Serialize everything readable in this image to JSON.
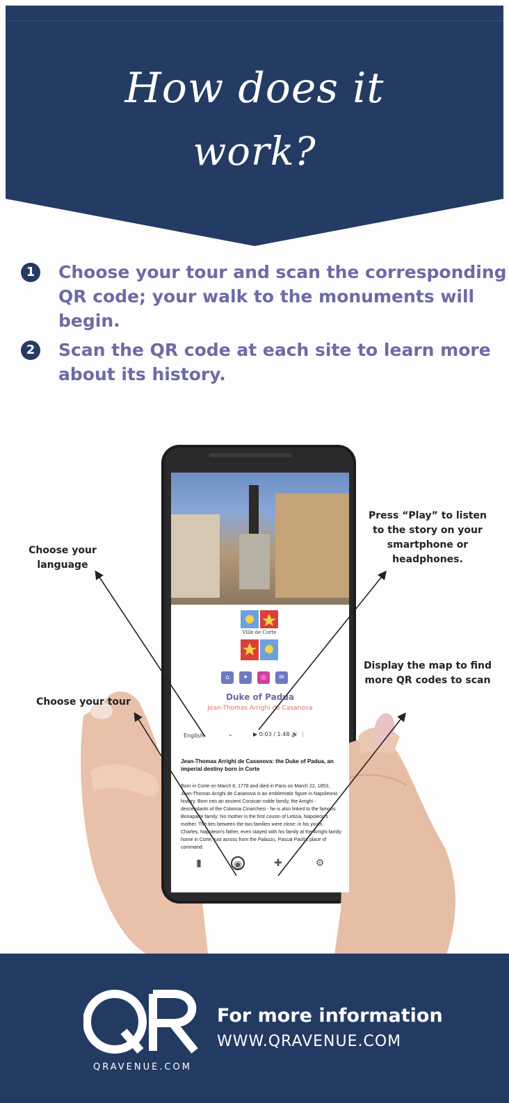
{
  "colors": {
    "navy": "#243b63",
    "step_text": "#6e6aa6",
    "subtitle_red": "#e06b68",
    "white": "#ffffff"
  },
  "header": {
    "title_line1": "How does it",
    "title_line2": "work?"
  },
  "steps": [
    {
      "number": "1",
      "text": "Choose your tour and scan the corresponding QR code; your walk to the monuments will begin."
    },
    {
      "number": "2",
      "text": "Scan the QR code at each site to learn more about its history."
    }
  ],
  "callouts": {
    "language": "Choose your language",
    "tour": "Choose your tour",
    "play": "Press “Play” to listen to the story on your smartphone or headphones.",
    "map": "Display the map to find more QR codes to scan"
  },
  "phone": {
    "coat_label": "Ville de Corte",
    "social_icons": [
      "home-icon",
      "twitter-icon",
      "instagram-icon",
      "mail-icon"
    ],
    "title": "Duke of Padua",
    "subtitle": "Jean-Thomas Arrighi de Casanova",
    "language_value": "English",
    "player_time": "0:03 / 1:48",
    "article_title": "Jean-Thomas Arrighi de Casanova: the Duke of Padua, an imperial destiny born in Corte",
    "article_body": "Born in Corte on March 8, 1778 and died in Paris on March 22, 1853, Jean-Thomas Arrighi de Casanova is an emblematic figure in Napoleonic history. Born into an ancient Corsican noble family, the Arrighi - descendants of the Colonna Cinarchesi - he is also linked to the famous Bonaparte family: his mother is the first cousin of Letizia, Napoleon's mother. The ties between the two families were close: in his youth, Charles, Napoleon's father, even stayed with his family at the Arrighi family home in Corte, just across from the Palazzu, Pascal Paoli's place of command.",
    "nav_icons": [
      "book-icon",
      "compass-icon",
      "map-icon",
      "settings-icon"
    ]
  },
  "footer": {
    "logo_text": "QR",
    "logo_caption": "QRAVENUE.COM",
    "info_title": "For more information",
    "website": "WWW.QRAVENUE.COM"
  }
}
